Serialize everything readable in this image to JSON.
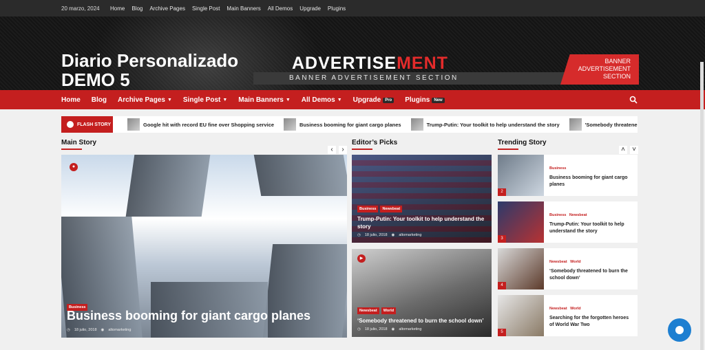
{
  "topbar": {
    "date": "20 marzo, 2024",
    "links": [
      "Home",
      "Blog",
      "Archive Pages",
      "Single Post",
      "Main Banners",
      "All Demos",
      "Upgrade",
      "Plugins"
    ]
  },
  "site": {
    "title": "Diario Personalizado DEMO 5"
  },
  "ad": {
    "word_left": "ADVERTISE",
    "word_right": "MENT",
    "sub": "BANNER ADVERTISEMENT SECTION",
    "banner": "BANNER ADVERTISEMENT SECTION"
  },
  "nav": {
    "items": [
      "Home",
      "Blog",
      "Archive Pages",
      "Single Post",
      "Main Banners",
      "All Demos",
      "Upgrade",
      "Plugins"
    ],
    "upgrade_pill": "Pro",
    "plugins_pill": "New"
  },
  "flash": {
    "label": "FLASH STORY",
    "items": [
      "Google hit with record EU fine over Shopping service",
      "Business booming for giant cargo planes",
      "Trump-Putin: Your toolkit to help understand the story",
      "'Somebody threatene"
    ]
  },
  "sections": {
    "main": "Main Story",
    "editors": "Editor’s Picks",
    "trending": "Trending Story"
  },
  "main_story": {
    "category": "Business",
    "title": "Business booming for giant cargo planes",
    "date": "18 julio, 2018",
    "author": "altomarketing"
  },
  "editors": [
    {
      "categories": [
        "Business",
        "Newsbeat"
      ],
      "title": "Trump-Putin: Your toolkit to help understand the story",
      "date": "18 julio, 2018",
      "author": "altomarketing"
    },
    {
      "categories": [
        "Newsbeat",
        "World"
      ],
      "title": "‘Somebody threatened to burn the school down’",
      "date": "18 julio, 2018",
      "author": "altomarketing"
    }
  ],
  "trending": [
    {
      "num": "2",
      "categories": [
        "Business"
      ],
      "title": "Business booming for giant cargo planes"
    },
    {
      "num": "3",
      "categories": [
        "Business",
        "Newsbeat"
      ],
      "title": "Trump-Putin: Your toolkit to help understand the story"
    },
    {
      "num": "4",
      "categories": [
        "Newsbeat",
        "World"
      ],
      "title": "‘Somebody threatened to burn the school down’"
    },
    {
      "num": "5",
      "categories": [
        "Newsbeat",
        "World"
      ],
      "title": "Searching for the forgotten heroes of World War Two"
    }
  ],
  "colors": {
    "accent": "#c41f1f",
    "topbar": "#2b2b2b",
    "chat": "#1d7fd1"
  },
  "icons": [
    "search-icon",
    "chevron-down-icon",
    "camera-icon",
    "video-icon",
    "clock-icon",
    "user-icon",
    "chat-icon"
  ]
}
